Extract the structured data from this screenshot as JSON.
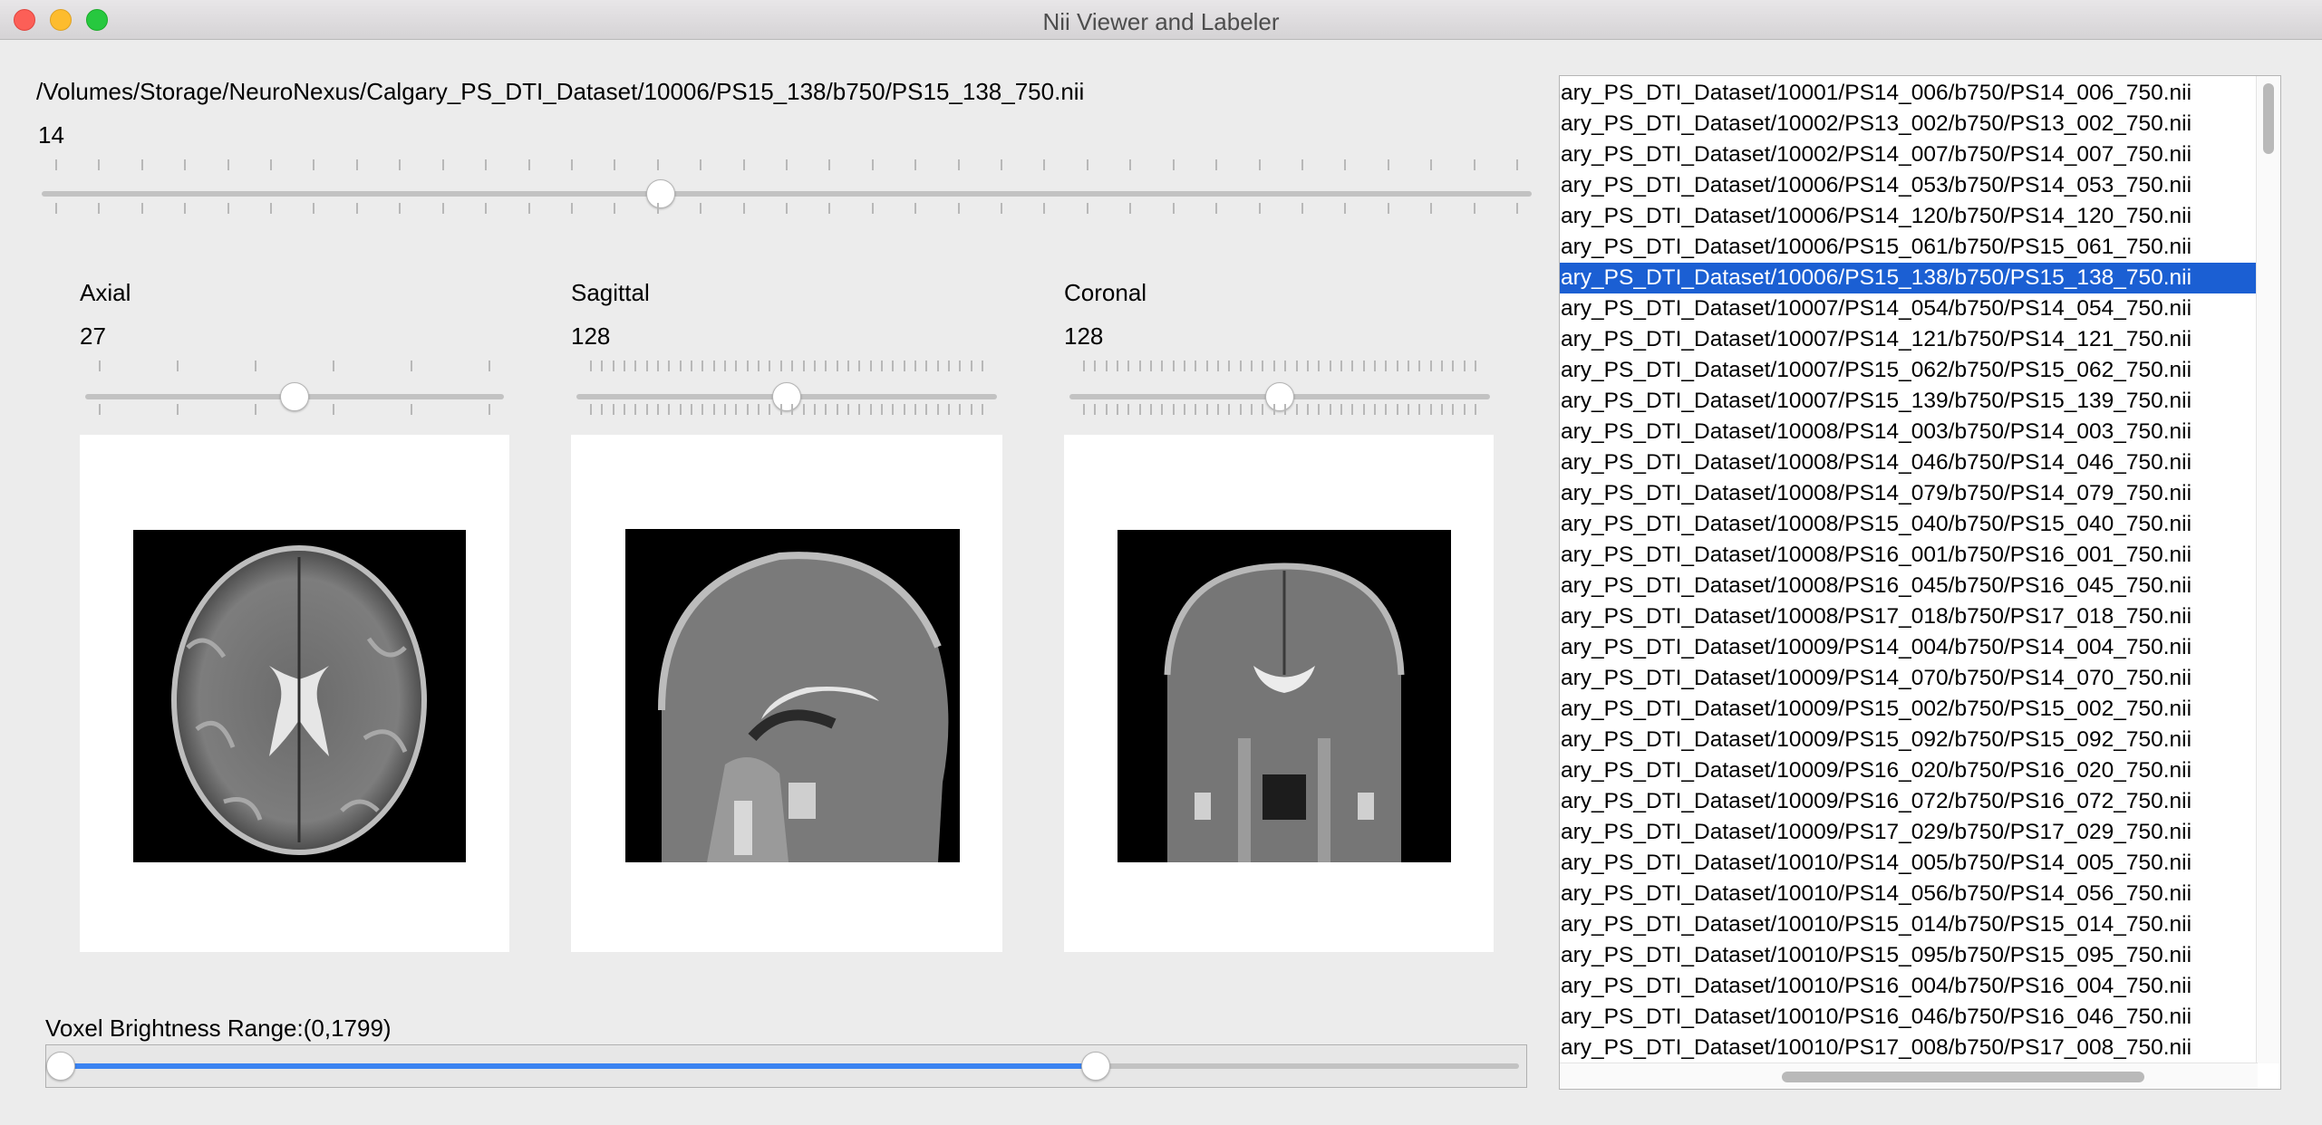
{
  "window": {
    "title": "Nii Viewer and Labeler"
  },
  "file_path": "/Volumes/Storage/NeuroNexus/Calgary_PS_DTI_Dataset/10006/PS15_138/b750/PS15_138_750.nii",
  "main_slider": {
    "value": "14",
    "fraction": 0.414
  },
  "views": [
    {
      "label": "Axial",
      "value": "27",
      "fraction": 0.5
    },
    {
      "label": "Sagittal",
      "value": "128",
      "fraction": 0.5
    },
    {
      "label": "Coronal",
      "value": "128",
      "fraction": 0.5
    }
  ],
  "brightness": {
    "label": "Voxel Brightness Range:(0,1799)",
    "low_fraction": 0.0,
    "high_fraction": 0.71,
    "accent": "#3a83f1"
  },
  "file_list": {
    "selected_index": 6,
    "selected_color": "#1b5fd3",
    "items": [
      "ary_PS_DTI_Dataset/10001/PS14_006/b750/PS14_006_750.nii",
      "ary_PS_DTI_Dataset/10002/PS13_002/b750/PS13_002_750.nii",
      "ary_PS_DTI_Dataset/10002/PS14_007/b750/PS14_007_750.nii",
      "ary_PS_DTI_Dataset/10006/PS14_053/b750/PS14_053_750.nii",
      "ary_PS_DTI_Dataset/10006/PS14_120/b750/PS14_120_750.nii",
      "ary_PS_DTI_Dataset/10006/PS15_061/b750/PS15_061_750.nii",
      "ary_PS_DTI_Dataset/10006/PS15_138/b750/PS15_138_750.nii",
      "ary_PS_DTI_Dataset/10007/PS14_054/b750/PS14_054_750.nii",
      "ary_PS_DTI_Dataset/10007/PS14_121/b750/PS14_121_750.nii",
      "ary_PS_DTI_Dataset/10007/PS15_062/b750/PS15_062_750.nii",
      "ary_PS_DTI_Dataset/10007/PS15_139/b750/PS15_139_750.nii",
      "ary_PS_DTI_Dataset/10008/PS14_003/b750/PS14_003_750.nii",
      "ary_PS_DTI_Dataset/10008/PS14_046/b750/PS14_046_750.nii",
      "ary_PS_DTI_Dataset/10008/PS14_079/b750/PS14_079_750.nii",
      "ary_PS_DTI_Dataset/10008/PS15_040/b750/PS15_040_750.nii",
      "ary_PS_DTI_Dataset/10008/PS16_001/b750/PS16_001_750.nii",
      "ary_PS_DTI_Dataset/10008/PS16_045/b750/PS16_045_750.nii",
      "ary_PS_DTI_Dataset/10008/PS17_018/b750/PS17_018_750.nii",
      "ary_PS_DTI_Dataset/10009/PS14_004/b750/PS14_004_750.nii",
      "ary_PS_DTI_Dataset/10009/PS14_070/b750/PS14_070_750.nii",
      "ary_PS_DTI_Dataset/10009/PS15_002/b750/PS15_002_750.nii",
      "ary_PS_DTI_Dataset/10009/PS15_092/b750/PS15_092_750.nii",
      "ary_PS_DTI_Dataset/10009/PS16_020/b750/PS16_020_750.nii",
      "ary_PS_DTI_Dataset/10009/PS16_072/b750/PS16_072_750.nii",
      "ary_PS_DTI_Dataset/10009/PS17_029/b750/PS17_029_750.nii",
      "ary_PS_DTI_Dataset/10010/PS14_005/b750/PS14_005_750.nii",
      "ary_PS_DTI_Dataset/10010/PS14_056/b750/PS14_056_750.nii",
      "ary_PS_DTI_Dataset/10010/PS15_014/b750/PS15_014_750.nii",
      "ary_PS_DTI_Dataset/10010/PS15_095/b750/PS15_095_750.nii",
      "ary_PS_DTI_Dataset/10010/PS16_004/b750/PS16_004_750.nii",
      "ary_PS_DTI_Dataset/10010/PS16_046/b750/PS16_046_750.nii",
      "ary_PS_DTI_Dataset/10010/PS17_008/b750/PS17_008_750.nii"
    ]
  }
}
